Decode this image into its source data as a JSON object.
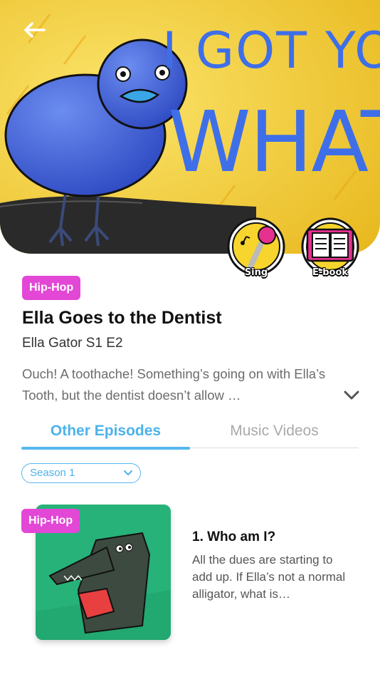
{
  "hero": {
    "artwork_text_line1": "I GOT YOU",
    "artwork_text_line2": "WHATUP",
    "actions": [
      {
        "label": "Sing",
        "icon": "microphone-icon"
      },
      {
        "label": "E-book",
        "icon": "book-icon"
      }
    ]
  },
  "show": {
    "genre": "Hip-Hop",
    "title": "Ella Goes to the Dentist",
    "subtitle": "Ella Gator S1 E2",
    "description": "Ouch! A toothache! Something’s going on with Ella’s Tooth, but the dentist doesn’t allow …"
  },
  "tabs": [
    {
      "label": "Other Episodes",
      "active": true
    },
    {
      "label": "Music Videos",
      "active": false
    }
  ],
  "season": {
    "selected": "Season 1"
  },
  "episodes": [
    {
      "genre": "Hip-Hop",
      "title": "1. Who am I?",
      "description": "All the dues are starting to add up. If Ella’s not a normal alligator, what is…"
    }
  ],
  "colors": {
    "accent_blue": "#4db3ea",
    "genre_pink": "#e347d6",
    "hero_yellow": "#f2d23a",
    "thumb_green": "#27b27a"
  }
}
